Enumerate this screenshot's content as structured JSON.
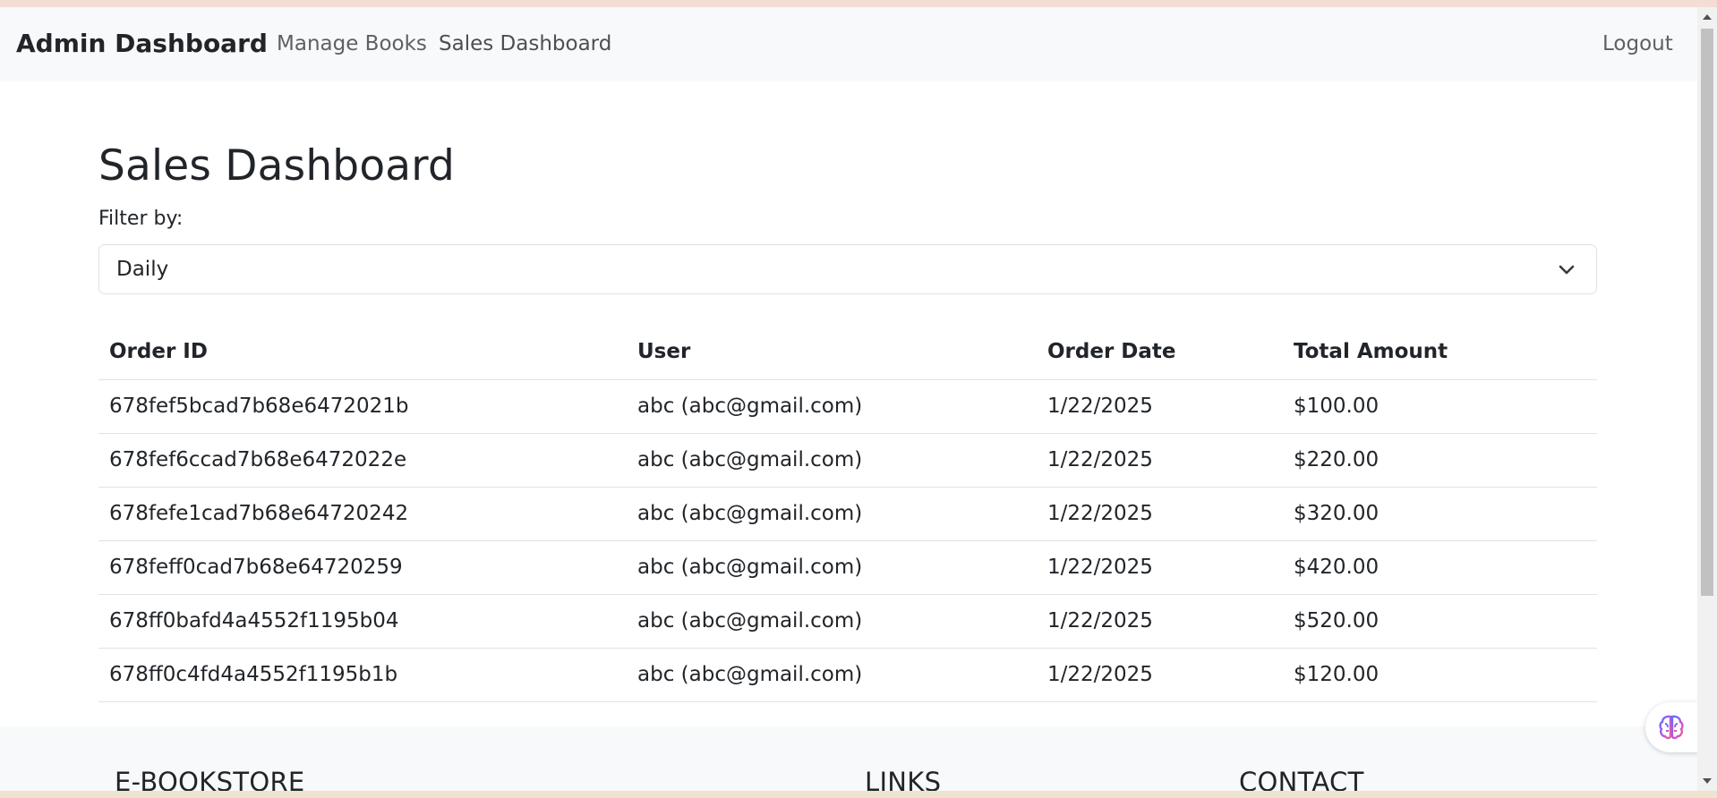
{
  "navbar": {
    "brand": "Admin Dashboard",
    "links": [
      {
        "label": "Manage Books"
      },
      {
        "label": "Sales Dashboard"
      }
    ],
    "logout": "Logout"
  },
  "main": {
    "title": "Sales Dashboard",
    "filter_label": "Filter by:",
    "filter_value": "Daily",
    "table": {
      "headers": [
        "Order ID",
        "User",
        "Order Date",
        "Total Amount"
      ],
      "rows": [
        [
          "678fef5bcad7b68e6472021b",
          "abc (abc@gmail.com)",
          "1/22/2025",
          "$100.00"
        ],
        [
          "678fef6ccad7b68e6472022e",
          "abc (abc@gmail.com)",
          "1/22/2025",
          "$220.00"
        ],
        [
          "678fefe1cad7b68e64720242",
          "abc (abc@gmail.com)",
          "1/22/2025",
          "$320.00"
        ],
        [
          "678feff0cad7b68e64720259",
          "abc (abc@gmail.com)",
          "1/22/2025",
          "$420.00"
        ],
        [
          "678ff0bafd4a4552f1195b04",
          "abc (abc@gmail.com)",
          "1/22/2025",
          "$520.00"
        ],
        [
          "678ff0c4fd4a4552f1195b1b",
          "abc (abc@gmail.com)",
          "1/22/2025",
          "$120.00"
        ]
      ]
    }
  },
  "footer": {
    "headings": [
      "E-BOOKSTORE",
      "LINKS",
      "CONTACT"
    ]
  },
  "icons": {
    "select": "chevron-down-icon",
    "widget": "brain-icon"
  },
  "colors": {
    "navbar_bg": "#f8f9fa",
    "text": "#212529",
    "nav_link": "#5c6166",
    "border": "#dee2e6"
  }
}
